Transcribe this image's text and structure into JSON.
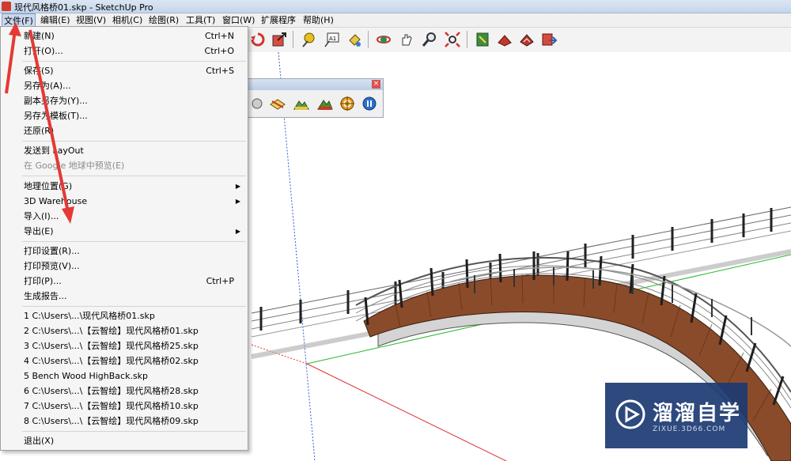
{
  "window": {
    "title": "现代风格桥01.skp - SketchUp Pro"
  },
  "menubar": [
    {
      "label": "文件(F)"
    },
    {
      "label": "编辑(E)"
    },
    {
      "label": "视图(V)"
    },
    {
      "label": "相机(C)"
    },
    {
      "label": "绘图(R)"
    },
    {
      "label": "工具(T)"
    },
    {
      "label": "窗口(W)"
    },
    {
      "label": "扩展程序"
    },
    {
      "label": "帮助(H)"
    }
  ],
  "file_menu": {
    "new": {
      "label": "新建(N)",
      "shortcut": "Ctrl+N"
    },
    "open": {
      "label": "打开(O)...",
      "shortcut": "Ctrl+O"
    },
    "save": {
      "label": "保存(S)",
      "shortcut": "Ctrl+S"
    },
    "save_as": {
      "label": "另存为(A)..."
    },
    "save_copy_as": {
      "label": "副本另存为(Y)..."
    },
    "save_as_template": {
      "label": "另存为模板(T)..."
    },
    "revert": {
      "label": "还原(R)"
    },
    "send_to_layout": {
      "label": "发送到 LayOut"
    },
    "preview_google_earth": {
      "label": "在 Google 地球中预览(E)"
    },
    "geo_location": {
      "label": "地理位置(G)"
    },
    "warehouse": {
      "label": "3D Warehouse"
    },
    "import": {
      "label": "导入(I)..."
    },
    "export": {
      "label": "导出(E)"
    },
    "print_setup": {
      "label": "打印设置(R)..."
    },
    "print_preview": {
      "label": "打印预览(V)..."
    },
    "print": {
      "label": "打印(P)...",
      "shortcut": "Ctrl+P"
    },
    "generate_report": {
      "label": "生成报告..."
    },
    "recent": [
      "1 C:\\Users\\...\\现代风格桥01.skp",
      "2 C:\\Users\\...\\【云智绘】现代风格桥01.skp",
      "3 C:\\Users\\...\\【云智绘】现代风格桥25.skp",
      "4 C:\\Users\\...\\【云智绘】现代风格桥02.skp",
      "5 Bench Wood HighBack.skp",
      "6 C:\\Users\\...\\【云智绘】现代风格桥28.skp",
      "7 C:\\Users\\...\\【云智绘】现代风格桥10.skp",
      "8 C:\\Users\\...\\【云智绘】现代风格桥09.skp"
    ],
    "exit": {
      "label": "退出(X)"
    },
    "submenu_arrow": "▶"
  },
  "palette": {
    "close_glyph": "×"
  },
  "toolbar_icons": [
    "rotate-icon",
    "scale-icon",
    "tape-measure-icon",
    "text-icon",
    "paint-bucket-icon",
    "orbit-icon",
    "pan-icon",
    "zoom-icon",
    "zoom-extents-icon",
    "warehouse-icon",
    "share-model-icon",
    "components-icon",
    "send-to-layout-icon"
  ],
  "colors": {
    "annotation_arrow": "#e53935",
    "menu_highlight": "#c9d8ee",
    "wood_deck": "#8a4b2a",
    "watermark_bg": "#1c3a72"
  },
  "watermark": {
    "text": "溜溜自学",
    "subtext": "ZIXUE.3D66.COM"
  }
}
